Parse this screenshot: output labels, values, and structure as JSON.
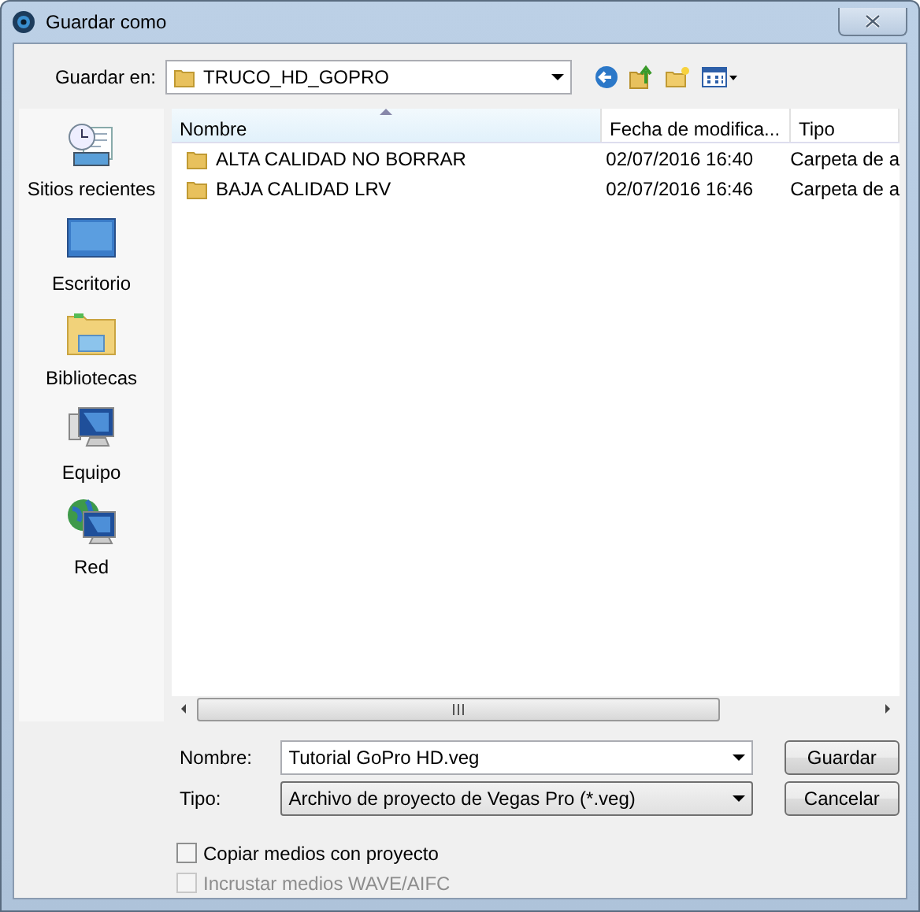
{
  "window": {
    "title": "Guardar como"
  },
  "location": {
    "label": "Guardar en:",
    "value": "TRUCO_HD_GOPRO"
  },
  "places": [
    {
      "label": "Sitios recientes"
    },
    {
      "label": "Escritorio"
    },
    {
      "label": "Bibliotecas"
    },
    {
      "label": "Equipo"
    },
    {
      "label": "Red"
    }
  ],
  "file_list": {
    "columns": [
      {
        "label": "Nombre",
        "sorted": true
      },
      {
        "label": "Fecha de modifica...",
        "sorted": false
      },
      {
        "label": "Tipo",
        "sorted": false
      }
    ],
    "rows": [
      {
        "name": "ALTA CALIDAD NO BORRAR",
        "date": "02/07/2016 16:40",
        "type": "Carpeta de a"
      },
      {
        "name": "BAJA CALIDAD LRV",
        "date": "02/07/2016 16:46",
        "type": "Carpeta de a"
      }
    ]
  },
  "file_name": {
    "label": "Nombre:",
    "value": "Tutorial GoPro HD.veg"
  },
  "file_type": {
    "label": "Tipo:",
    "value": "Archivo de proyecto de Vegas Pro (*.veg)"
  },
  "buttons": [
    "Guardar",
    "Cancelar"
  ],
  "options": [
    {
      "label": "Copiar medios con proyecto",
      "checked": false,
      "disabled": false
    },
    {
      "label": "Incrustar medios WAVE/AIFC",
      "checked": false,
      "disabled": true
    }
  ]
}
